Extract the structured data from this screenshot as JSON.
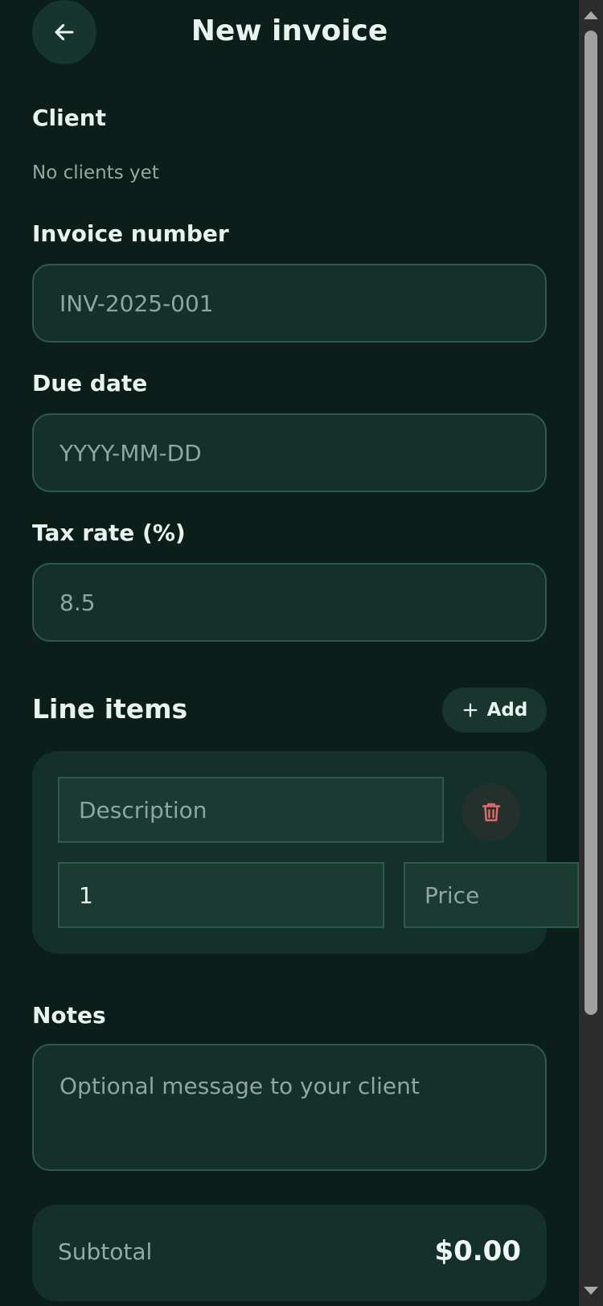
{
  "header": {
    "title": "New invoice",
    "back_icon": "arrow-left-icon"
  },
  "client": {
    "label": "Client",
    "empty_text": "No clients yet"
  },
  "invoice_number": {
    "label": "Invoice number",
    "placeholder": "INV-2025-001"
  },
  "due_date": {
    "label": "Due date",
    "placeholder": "YYYY-MM-DD"
  },
  "tax_rate": {
    "label": "Tax rate (%)",
    "placeholder": "8.5"
  },
  "line_items": {
    "title": "Line items",
    "add_label": "Add",
    "items": [
      {
        "description_placeholder": "Description",
        "quantity_value": "1",
        "price_placeholder": "Price",
        "delete_icon": "trash-icon"
      }
    ]
  },
  "notes": {
    "label": "Notes",
    "placeholder": "Optional message to your client"
  },
  "summary": {
    "subtotal_label": "Subtotal",
    "subtotal_value": "$0.00"
  },
  "colors": {
    "background": "#0b1e19",
    "card": "#15302a",
    "border": "#2e5a4c",
    "text": "#e8f3ef",
    "muted": "#93aaa3",
    "danger": "#e06a6a"
  }
}
